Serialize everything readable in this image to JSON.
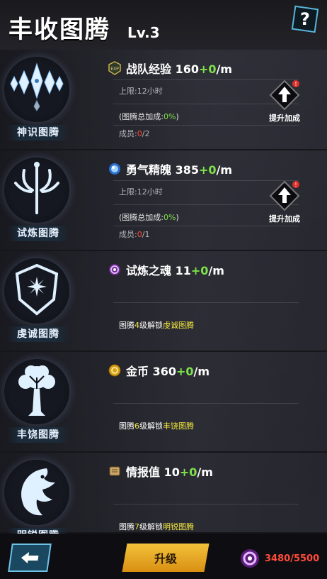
{
  "header": {
    "title": "丰收图腾",
    "level": "Lv.3",
    "help": "?"
  },
  "rows": [
    {
      "totem_label": "神识图腾",
      "resource": {
        "name": "战队经验",
        "value": "160",
        "plus": "+0",
        "unit": "/m",
        "icon": "exp-badge-icon"
      },
      "cap": "上限:12小时",
      "bonus": {
        "prefix": "(图腾总加成:",
        "value": "0%",
        "suffix": ")"
      },
      "members": {
        "prefix": "成员:",
        "current": "0",
        "sep": "/",
        "max": "2"
      },
      "boost_label": "提升加成"
    },
    {
      "totem_label": "试炼图腾",
      "resource": {
        "name": "勇气精魄",
        "value": "385",
        "plus": "+0",
        "unit": "/m",
        "icon": "blue-orb-icon"
      },
      "cap": "上限:12小时",
      "bonus": {
        "prefix": "(图腾总加成:",
        "value": "0%",
        "suffix": ")"
      },
      "members": {
        "prefix": "成员:",
        "current": "0",
        "sep": "/",
        "max": "1"
      },
      "boost_label": "提升加成"
    },
    {
      "totem_label": "虔诚图腾",
      "resource": {
        "name": "试炼之魂",
        "value": "11",
        "plus": "+0",
        "unit": "/m",
        "icon": "purple-soul-icon"
      },
      "unlock": {
        "pre": "图腾",
        "level": "4",
        "mid": "级解锁",
        "target": "虔诚图腾"
      }
    },
    {
      "totem_label": "丰饶图腾",
      "resource": {
        "name": "金币",
        "value": "360",
        "plus": "+0",
        "unit": "/m",
        "icon": "gold-coin-icon"
      },
      "unlock": {
        "pre": "图腾",
        "level": "6",
        "mid": "级解锁",
        "target": "丰饶图腾"
      }
    },
    {
      "totem_label": "明锐图腾",
      "resource": {
        "name": "情报值",
        "value": "10",
        "plus": "+0",
        "unit": "/m",
        "icon": "intel-scroll-icon"
      },
      "unlock": {
        "pre": "图腾",
        "level": "7",
        "mid": "级解锁",
        "target": "明锐图腾"
      }
    }
  ],
  "footer": {
    "upgrade_label": "升级",
    "cost_current": "3480",
    "cost_sep": "/",
    "cost_max": "5500"
  },
  "colors": {
    "green": "#7ee24a",
    "red": "#ff4b3a",
    "yellow": "#f1e640",
    "gold": "#f3c23b"
  }
}
